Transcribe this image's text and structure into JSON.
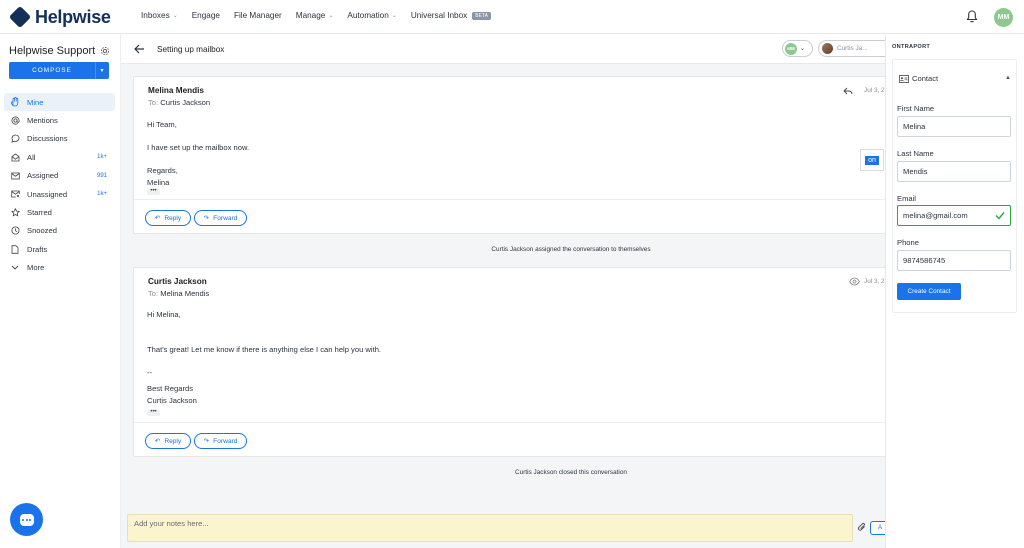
{
  "app": {
    "brand": "Helpwise",
    "avatar_initials": "MM",
    "accent": "#1a73e8"
  },
  "nav": [
    {
      "label": "Inboxes",
      "caret": true
    },
    {
      "label": "Engage",
      "caret": false
    },
    {
      "label": "File Manager",
      "caret": false
    },
    {
      "label": "Manage",
      "caret": true
    },
    {
      "label": "Automation",
      "caret": true
    },
    {
      "label": "Universal Inbox",
      "badge": "BETA"
    }
  ],
  "sidebar": {
    "title": "Helpwise Support",
    "compose_label": "COMPOSE",
    "items": [
      {
        "label": "Mine",
        "icon": "hand-icon",
        "count": "",
        "active": true
      },
      {
        "label": "Mentions",
        "icon": "at-icon",
        "count": ""
      },
      {
        "label": "Discussions",
        "icon": "chat-bubble-icon",
        "count": ""
      },
      {
        "label": "All",
        "icon": "envelope-open-icon",
        "count": "1k+"
      },
      {
        "label": "Assigned",
        "icon": "envelope-icon",
        "count": "991"
      },
      {
        "label": "Unassigned",
        "icon": "envelope-x-icon",
        "count": "1k+"
      },
      {
        "label": "Starred",
        "icon": "star-icon",
        "count": ""
      },
      {
        "label": "Snoozed",
        "icon": "clock-icon",
        "count": ""
      },
      {
        "label": "Drafts",
        "icon": "file-icon",
        "count": ""
      },
      {
        "label": "More",
        "icon": "chevron-down-icon",
        "count": ""
      }
    ]
  },
  "conversation": {
    "subject": "Setting up mailbox",
    "assignee_initials": "MM",
    "user_pill": "Curtis Ja...",
    "messages": [
      {
        "from": "Melina Mendis",
        "to_label": "To:",
        "to": "Curtis Jackson",
        "date": "Jul 3, 2",
        "lines": [
          "Hi Team,",
          "I have set up the mailbox now.",
          "Regards,",
          "Melina"
        ]
      },
      {
        "from": "Curtis Jackson",
        "to_label": "To:",
        "to": "Melina Mendis",
        "date": "Jul 3, 2",
        "lines": [
          "Hi Melina,",
          "That's great! Let me know if there is anything else I can help you with.",
          "--",
          "Best Regards",
          "Curtis Jackson"
        ]
      }
    ],
    "reply_label": "Reply",
    "forward_label": "Forward",
    "dots": "•••",
    "events": [
      "Curtis Jackson assigned the conversation to themselves",
      "Curtis Jackson closed this conversation"
    ],
    "notes_placeholder": "Add your notes here...",
    "add_label": "A",
    "ontraport_badge": "on"
  },
  "panel": {
    "title": "ONTRAPORT",
    "section": "Contact",
    "fields": [
      {
        "label": "First Name",
        "value": "Melina"
      },
      {
        "label": "Last Name",
        "value": "Mendis"
      },
      {
        "label": "Email",
        "value": "melina@gmail.com",
        "valid": true
      },
      {
        "label": "Phone",
        "value": "9874586745"
      }
    ],
    "create_label": "Create Contact"
  }
}
